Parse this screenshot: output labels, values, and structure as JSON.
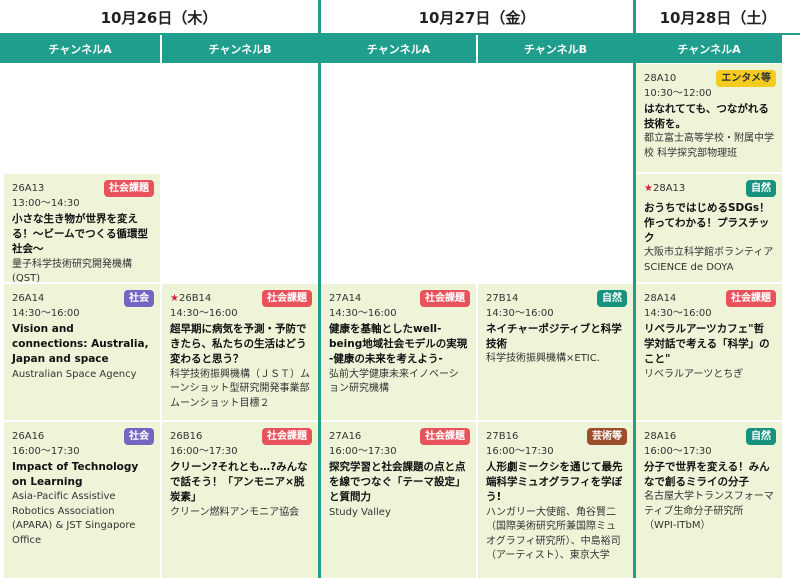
{
  "days": [
    "10月26日（木）",
    "10月27日（金）",
    "10月28日（土）"
  ],
  "channels": [
    "チャンネルA",
    "チャンネルB",
    "チャンネルA",
    "チャンネルB",
    "チャンネルA"
  ],
  "cells": {
    "c1r2": {
      "code": "26A13",
      "time": "13:00～14:30",
      "title": "小さな生き物が世界を変える！～ビームでつくる循環型社会～",
      "org": "量子科学技術研究開発機構(QST)",
      "badge": "社会課題"
    },
    "c1r3": {
      "code": "26A14",
      "time": "14:30～16:00",
      "title": "Vision and connections: Australia, Japan and space",
      "org": "Australian Space Agency",
      "badge": "社会"
    },
    "c1r4": {
      "code": "26A16",
      "time": "16:00～17:30",
      "title": "Impact of Technology on Learning",
      "org": "Asia-Pacific Assistive Robotics Association (APARA) & JST Singapore Office",
      "badge": "社会"
    },
    "c2r3": {
      "code": "26B14",
      "time": "14:30～16:00",
      "title": "超早期に病気を予測・予防できたら、私たちの生活はどう変わると思う？",
      "org": "科学技術振興機構（ＪＳＴ）ムーンショット型研究開発事業部 ムーンショット目標２",
      "badge": "社会課題",
      "star": "★"
    },
    "c2r4": {
      "code": "26B16",
      "time": "16:00～17:30",
      "title": "クリーン?それとも…?みんなで話そう！「アンモニア×脱炭素」",
      "org": "クリーン燃料アンモニア協会",
      "badge": "社会課題"
    },
    "c3r3": {
      "code": "27A14",
      "time": "14:30～16:00",
      "title": "健康を基軸としたwell-being地域社会モデルの実現 -健康の未来を考えよう-",
      "org": "弘前大学健康未来イノベーション研究機構",
      "badge": "社会課題"
    },
    "c3r4": {
      "code": "27A16",
      "time": "16:00～17:30",
      "title": "探究学習と社会課題の点と点を線でつなぐ「テーマ設定」と質問力",
      "org": "Study Valley",
      "badge": "社会課題"
    },
    "c4r3": {
      "code": "27B14",
      "time": "14:30～16:00",
      "title": "ネイチャーポジティブと科学技術",
      "org": "科学技術振興機構×ETIC.",
      "badge": "自然"
    },
    "c4r4": {
      "code": "27B16",
      "time": "16:00～17:30",
      "title": "人形劇ミークシを通じて最先端科学ミュオグラフィを学ぼう!",
      "org": "ハンガリー大使館、角谷賢二（国際美術研究所兼国際ミュオグラフィ研究所）、中島裕司（アーティスト）、東京大学",
      "badge": "芸術等"
    },
    "c5r1": {
      "code": "28A10",
      "time": "10:30～12:00",
      "title": "はなれてても、つながれる技術を。",
      "org": "都立富士高等学校・附属中学校 科学探究部物理班",
      "badge": "エンタメ等"
    },
    "c5r2": {
      "code": "28A13",
      "time": "",
      "title": "おうちではじめるSDGs！作ってわかる！プラスチック",
      "org": "大阪市立科学館ボランティア SCIENCE de DOYA",
      "badge": "自然",
      "star": "★"
    },
    "c5r3": {
      "code": "28A14",
      "time": "14:30～16:00",
      "title": "リベラルアーツカフェ\"哲学対話で考える「科学」のこと\"",
      "org": "リベラルアーツとちぎ",
      "badge": "社会課題"
    },
    "c5r4": {
      "code": "28A16",
      "time": "16:00～17:30",
      "title": "分子で世界を変える！みんなで創るミライの分子",
      "org": "名古屋大学トランスフォーマティブ生命分子研究所（WPI-ITbM）",
      "badge": "自然"
    }
  }
}
